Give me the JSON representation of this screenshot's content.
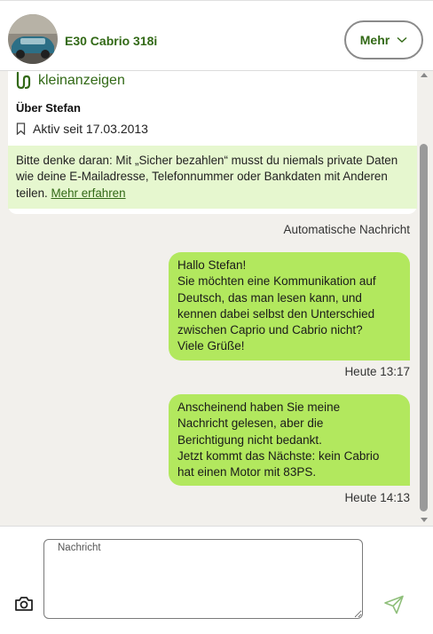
{
  "header": {
    "title": "E30 Cabrio 318i",
    "more_button": "Mehr"
  },
  "info": {
    "brand": "kleinanzeigen",
    "about_title": "Über Stefan",
    "active_since": "Aktiv seit 17.03.2013",
    "warning_text": "Bitte denke daran: Mit „Sicher bezahlen“ musst du niemals private Daten wie deine E-Mailadresse, Telefonnummer oder Bankdaten mit Anderen teilen.",
    "warning_link": "Mehr erfahren"
  },
  "auto_label": "Automatische Nachricht",
  "messages": [
    {
      "lines": [
        "Hallo Stefan!",
        "Sie möchten eine Kommunikation auf",
        "Deutsch, das man lesen kann, und",
        "kennen dabei selbst den Unterschied",
        "zwischen Caprio und Cabrio nicht?",
        "Viele Grüße!"
      ],
      "time": "Heute 13:17"
    },
    {
      "lines": [
        "Anscheinend haben Sie meine",
        "Nachricht gelesen, aber die",
        "Berichtigung nicht bedankt.",
        "Jetzt kommt das Nächste: kein Cabrio",
        "hat einen Motor mit 83PS."
      ],
      "time": "Heute 14:13"
    }
  ],
  "compose": {
    "label": "Nachricht",
    "value": ""
  },
  "colors": {
    "brand_green": "#326916",
    "bubble_green": "#b2e85e",
    "warning_bg": "#e6f7cf",
    "chat_bg": "#f2f0ec"
  }
}
